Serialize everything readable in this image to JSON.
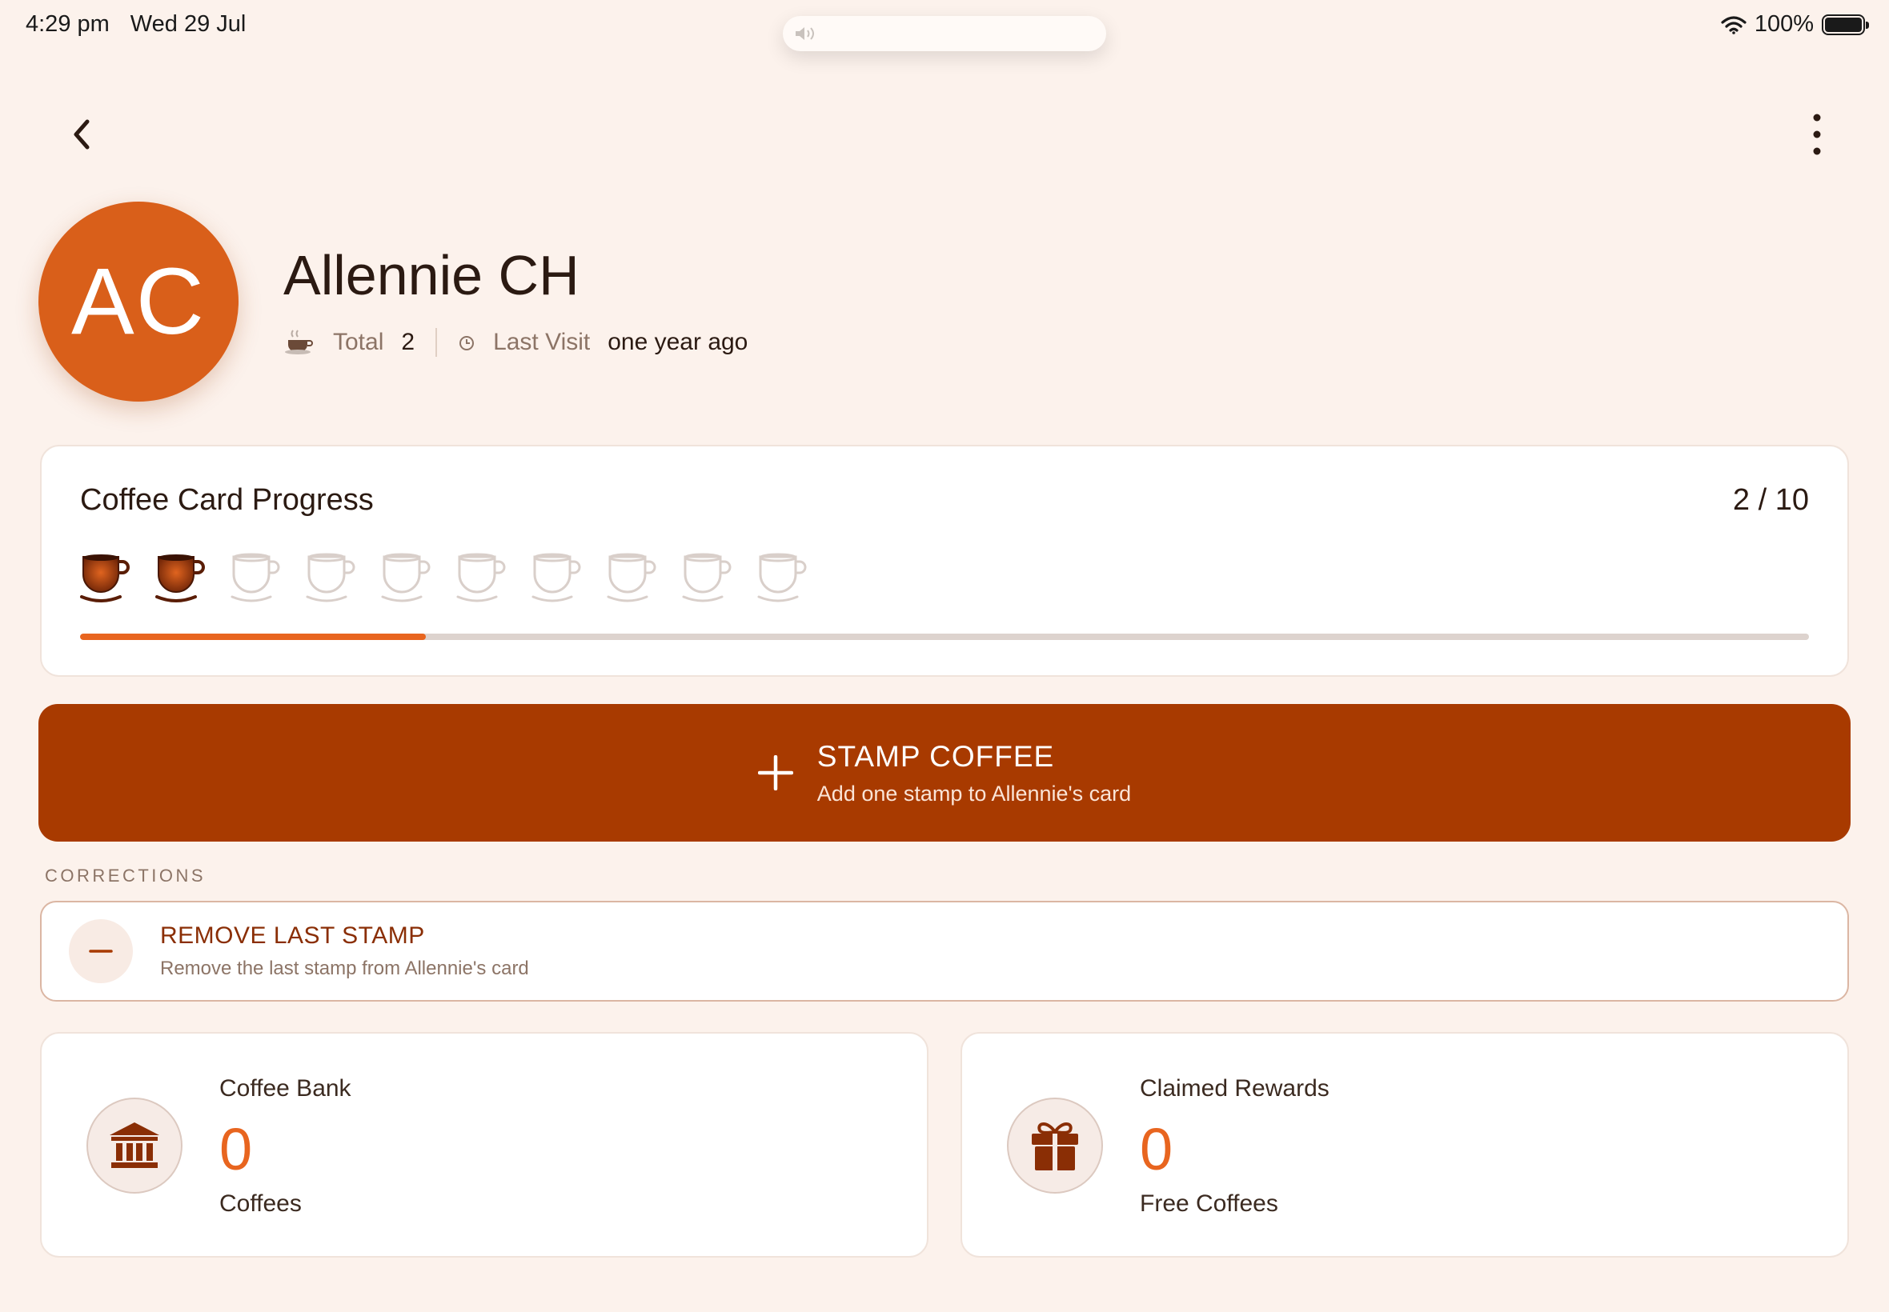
{
  "status_bar": {
    "time": "4:29 pm",
    "date": "Wed 29 Jul",
    "battery": "100%"
  },
  "customer": {
    "initials": "AC",
    "name": "Allennie CH",
    "total_label": "Total",
    "total_value": "2",
    "last_visit_label": "Last Visit",
    "last_visit_value": "one year ago"
  },
  "progress": {
    "title": "Coffee Card Progress",
    "count_text": "2 / 10",
    "stamped": 2,
    "total": 10,
    "fraction": 0.2
  },
  "stamp_button": {
    "title": "STAMP COFFEE",
    "subtitle": "Add one stamp to Allennie's card"
  },
  "corrections": {
    "section_label": "CORRECTIONS",
    "remove_title": "REMOVE LAST STAMP",
    "remove_subtitle": "Remove the last stamp from Allennie's card"
  },
  "stats": {
    "bank": {
      "label": "Coffee Bank",
      "value": "0",
      "unit": "Coffees",
      "icon": "bank-icon"
    },
    "rewards": {
      "label": "Claimed Rewards",
      "value": "0",
      "unit": "Free Coffees",
      "icon": "gift-icon"
    }
  },
  "colors": {
    "background": "#fcf2ec",
    "accent": "#e8651f",
    "avatar": "#d95f1a",
    "button": "#a83a00",
    "dark_brown": "#8a2e05"
  }
}
